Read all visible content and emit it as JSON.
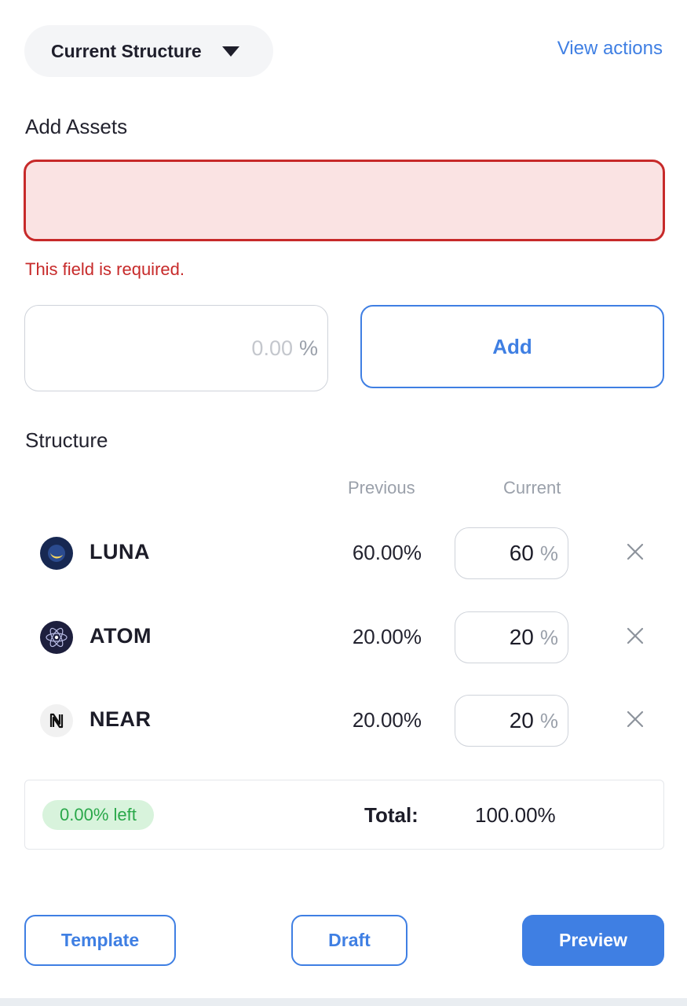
{
  "header": {
    "structure_select_label": "Current Structure",
    "view_actions_label": "View actions"
  },
  "add_assets": {
    "label": "Add Assets",
    "asset_value": "",
    "error": "This field is required.",
    "percent_placeholder": "0.00",
    "percent_unit": "%",
    "add_label": "Add"
  },
  "structure": {
    "label": "Structure",
    "col_previous": "Previous",
    "col_current": "Current",
    "rows": [
      {
        "name": "LUNA",
        "icon": "luna-icon",
        "previous": "60.00%",
        "current": "60",
        "unit": "%"
      },
      {
        "name": "ATOM",
        "icon": "atom-icon",
        "previous": "20.00%",
        "current": "20",
        "unit": "%"
      },
      {
        "name": "NEAR",
        "icon": "near-icon",
        "previous": "20.00%",
        "current": "20",
        "unit": "%"
      }
    ]
  },
  "summary": {
    "left_badge": "0.00% left",
    "total_label": "Total:",
    "total_value": "100.00%"
  },
  "actions": {
    "template_label": "Template",
    "draft_label": "Draft",
    "preview_label": "Preview"
  },
  "colors": {
    "accent": "#3f7fe3",
    "error": "#c72a2a",
    "error_bg": "#fae3e3",
    "success": "#2aa84a",
    "success_bg": "#d8f3dc"
  }
}
